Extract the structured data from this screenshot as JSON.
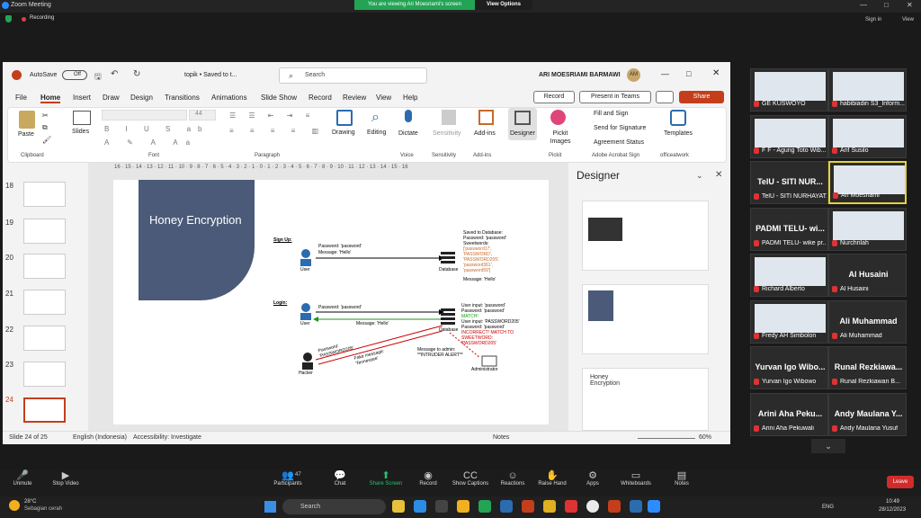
{
  "zoom": {
    "window_title": "Zoom Meeting",
    "viewing_banner": "You are viewing Ari Moesriami's screen",
    "view_options": "View Options",
    "recording": "Recording",
    "sign_in": "Sign in",
    "view": "View"
  },
  "ppt": {
    "autosave": "AutoSave",
    "autosave_state": "Off",
    "doc_title": "topik  •  Saved to t...",
    "search_placeholder": "Search",
    "user_name": "ARI MOESRIAMI BARMAWI",
    "user_initials": "AM",
    "menu": [
      "File",
      "Home",
      "Insert",
      "Draw",
      "Design",
      "Transitions",
      "Animations",
      "Slide Show",
      "Record",
      "Review",
      "View",
      "Help"
    ],
    "record_btn": "Record",
    "teams_btn": "Present in Teams",
    "share_btn": "Share",
    "ribbon": {
      "paste": "Paste",
      "slides": "Slides",
      "font_size": "44",
      "drawing": "Drawing",
      "editing": "Editing",
      "dictate": "Dictate",
      "sensitivity": "Sensitivity",
      "addins": "Add-ins",
      "designer": "Designer",
      "pickit": "Pickit Images",
      "fill_sign": "Fill and Sign",
      "send_sig": "Send for Signature",
      "agreement": "Agreement Status",
      "templates": "Templates",
      "groups": [
        "Clipboard",
        "Font",
        "Paragraph",
        "Voice",
        "Sensitivity",
        "Add-ins",
        "Pickit",
        "Adobe Acrobat Sign",
        "officeatwork"
      ]
    },
    "slide_numbers": [
      "18",
      "19",
      "20",
      "21",
      "22",
      "23",
      "24"
    ],
    "ruler": "16 · 15 · 14 · 13 · 12 · 11 · 10 · 9 · 8 · 7 · 6 · 5 · 4 · 3 · 2 · 1 · 0 · 1 · 2 · 3 · 4 · 5 · 6 · 7 · 8 · 9 · 10 · 11 · 12 · 13 · 14 · 15 · 16",
    "slide": {
      "title": "Honey Encryption",
      "signup": "Sign Up:",
      "login": "Login:",
      "user": "User",
      "database": "Database",
      "hacker": "Hacker",
      "administrator": "Administrator",
      "pw_msg1": "Password: 'password'",
      "msg_hello": "Message: 'Hello'",
      "saved_db": "Saved to Database:",
      "saved_pw": "Password: 'password'",
      "sweetwords": "Sweetwords:",
      "sw_list": "['password17', 'PASSWORD', 'PASSWORD205', 'password361', 'password59']",
      "msg_hello2": "Message: 'Hello'",
      "login_pw": "Password: 'password'",
      "login_msg": "Message: 'Hello'",
      "user_input1": "User input: 'password'",
      "pw_check1": "Password: 'password'",
      "match": "MATCH!",
      "user_input2": "User input: 'PASSWORD205'",
      "pw_check2": "Password: 'password'",
      "incorrect": "INCORRECT! MATCH TO SWEETWORD: 'PASSWORD205'",
      "hacker_pw": "Password: 'PASSWORD205'",
      "fake_msg": "Fake message: 'Tennessee'",
      "admin_msg": "Message to admin: **INTRUDER ALERT**"
    },
    "designer_title": "Designer",
    "designer_card3_title": "Honey Encryption",
    "status": {
      "slide": "Slide 24 of 25",
      "lang": "English (Indonesia)",
      "access": "Accessibility: Investigate",
      "notes": "Notes",
      "zoom": "60%"
    }
  },
  "gallery": [
    {
      "name": "GE KUSWOYO",
      "big": ""
    },
    {
      "name": "habibiadin S3_Inform...",
      "big": ""
    },
    {
      "name": "F F - Agung Toto Wib...",
      "big": ""
    },
    {
      "name": "Arif Susilo",
      "big": ""
    },
    {
      "name": "TelU - SITI NURHAYAT...",
      "big": "TelU - SITI NUR..."
    },
    {
      "name": "Ari Moesriami",
      "big": ""
    },
    {
      "name": "PADMI TELU- wike pr...",
      "big": "PADMI TELU- wi..."
    },
    {
      "name": "Nurchrilah",
      "big": ""
    },
    {
      "name": "Richard Alberto",
      "big": ""
    },
    {
      "name": "Al Husaini",
      "big": "Al Husaini"
    },
    {
      "name": "Fredy AH Simbolon",
      "big": ""
    },
    {
      "name": "Ali Muhammad",
      "big": "Ali Muhammad"
    },
    {
      "name": "Yurvan Igo Wibowo",
      "big": "Yurvan Igo Wibo..."
    },
    {
      "name": "Runal Rezkiawan B...",
      "big": "Runal Rezkiawa..."
    },
    {
      "name": "Arini Aha Pekuwali",
      "big": "Arini Aha Peku..."
    },
    {
      "name": "Andy Maulana Yusuf",
      "big": "Andy Maulana Y..."
    }
  ],
  "toolbar": {
    "unmute": "Unmute",
    "stop_video": "Stop Video",
    "participants": "Participants",
    "participants_count": "47",
    "chat": "Chat",
    "share_screen": "Share Screen",
    "record": "Record",
    "captions": "Show Captions",
    "reactions": "Reactions",
    "raise_hand": "Raise Hand",
    "apps": "Apps",
    "whiteboards": "Whiteboards",
    "notes": "Notes",
    "leave": "Leave"
  },
  "taskbar": {
    "temp": "28°C",
    "weather": "Sebagian cerah",
    "search": "Search",
    "lang": "ENG",
    "time": "10:49",
    "date": "28/12/2023"
  }
}
